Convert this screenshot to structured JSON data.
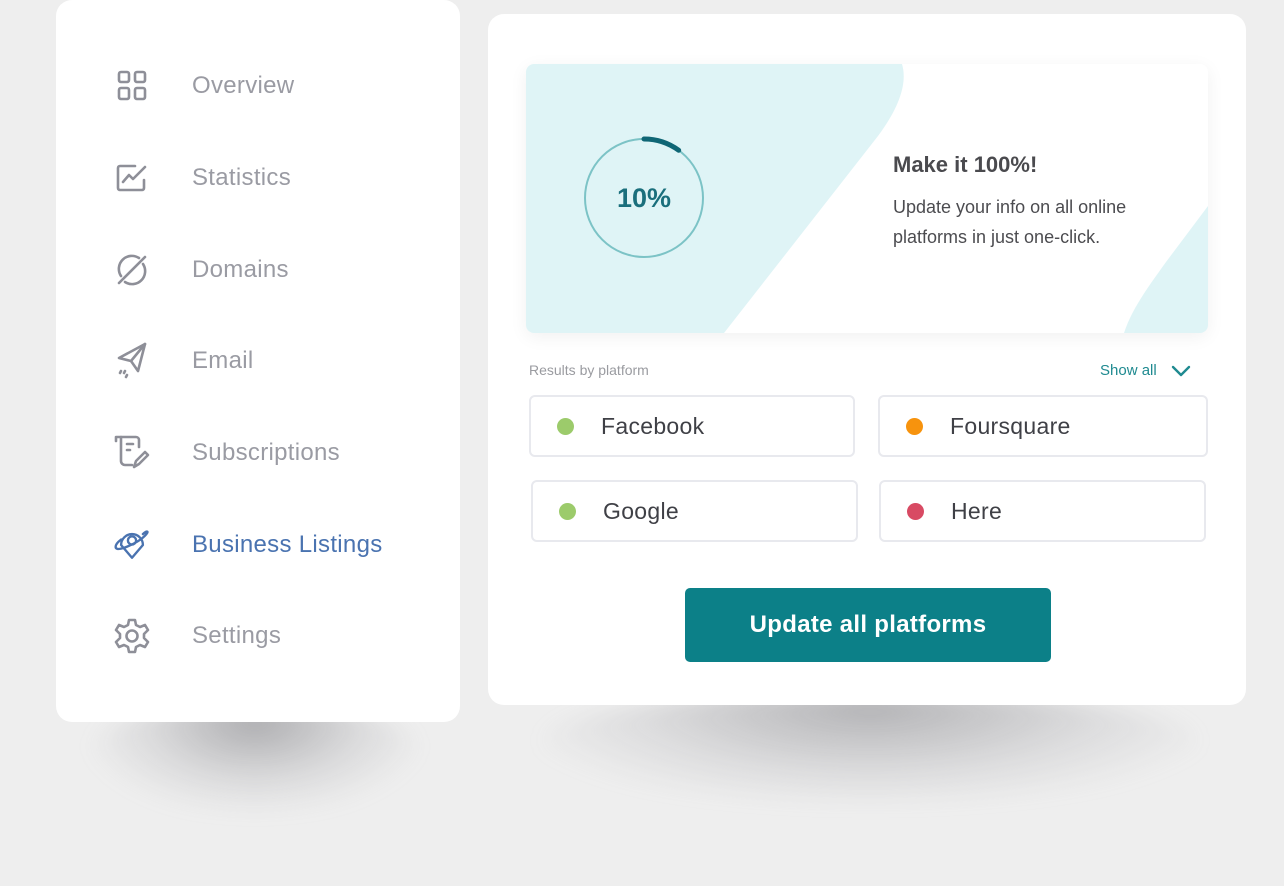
{
  "sidebar": {
    "items": [
      {
        "label": "Overview",
        "icon": "grid-icon",
        "active": false
      },
      {
        "label": "Statistics",
        "icon": "chart-icon",
        "active": false
      },
      {
        "label": "Domains",
        "icon": "globe-slash-icon",
        "active": false
      },
      {
        "label": "Email",
        "icon": "paper-plane-icon",
        "active": false
      },
      {
        "label": "Subscriptions",
        "icon": "scroll-pen-icon",
        "active": false
      },
      {
        "label": "Business Listings",
        "icon": "location-pin-icon",
        "active": true
      },
      {
        "label": "Settings",
        "icon": "gear-icon",
        "active": false
      }
    ]
  },
  "promo": {
    "progress_value": "10%",
    "progress_fraction": 0.1,
    "title": "Make it 100%!",
    "description": "Update your info on all online platforms in just one-click."
  },
  "results": {
    "label": "Results by platform",
    "show_all_label": "Show all",
    "platforms": [
      {
        "name": "Facebook",
        "status_color": "#9ccb6b"
      },
      {
        "name": "Foursquare",
        "status_color": "#f7930d"
      },
      {
        "name": "Google",
        "status_color": "#9ccb6b"
      },
      {
        "name": "Here",
        "status_color": "#d84a63"
      }
    ]
  },
  "actions": {
    "update_label": "Update all platforms"
  },
  "colors": {
    "accent": "#0c8088",
    "active_nav": "#4a73b0",
    "promo_bg": "#dff4f6"
  }
}
